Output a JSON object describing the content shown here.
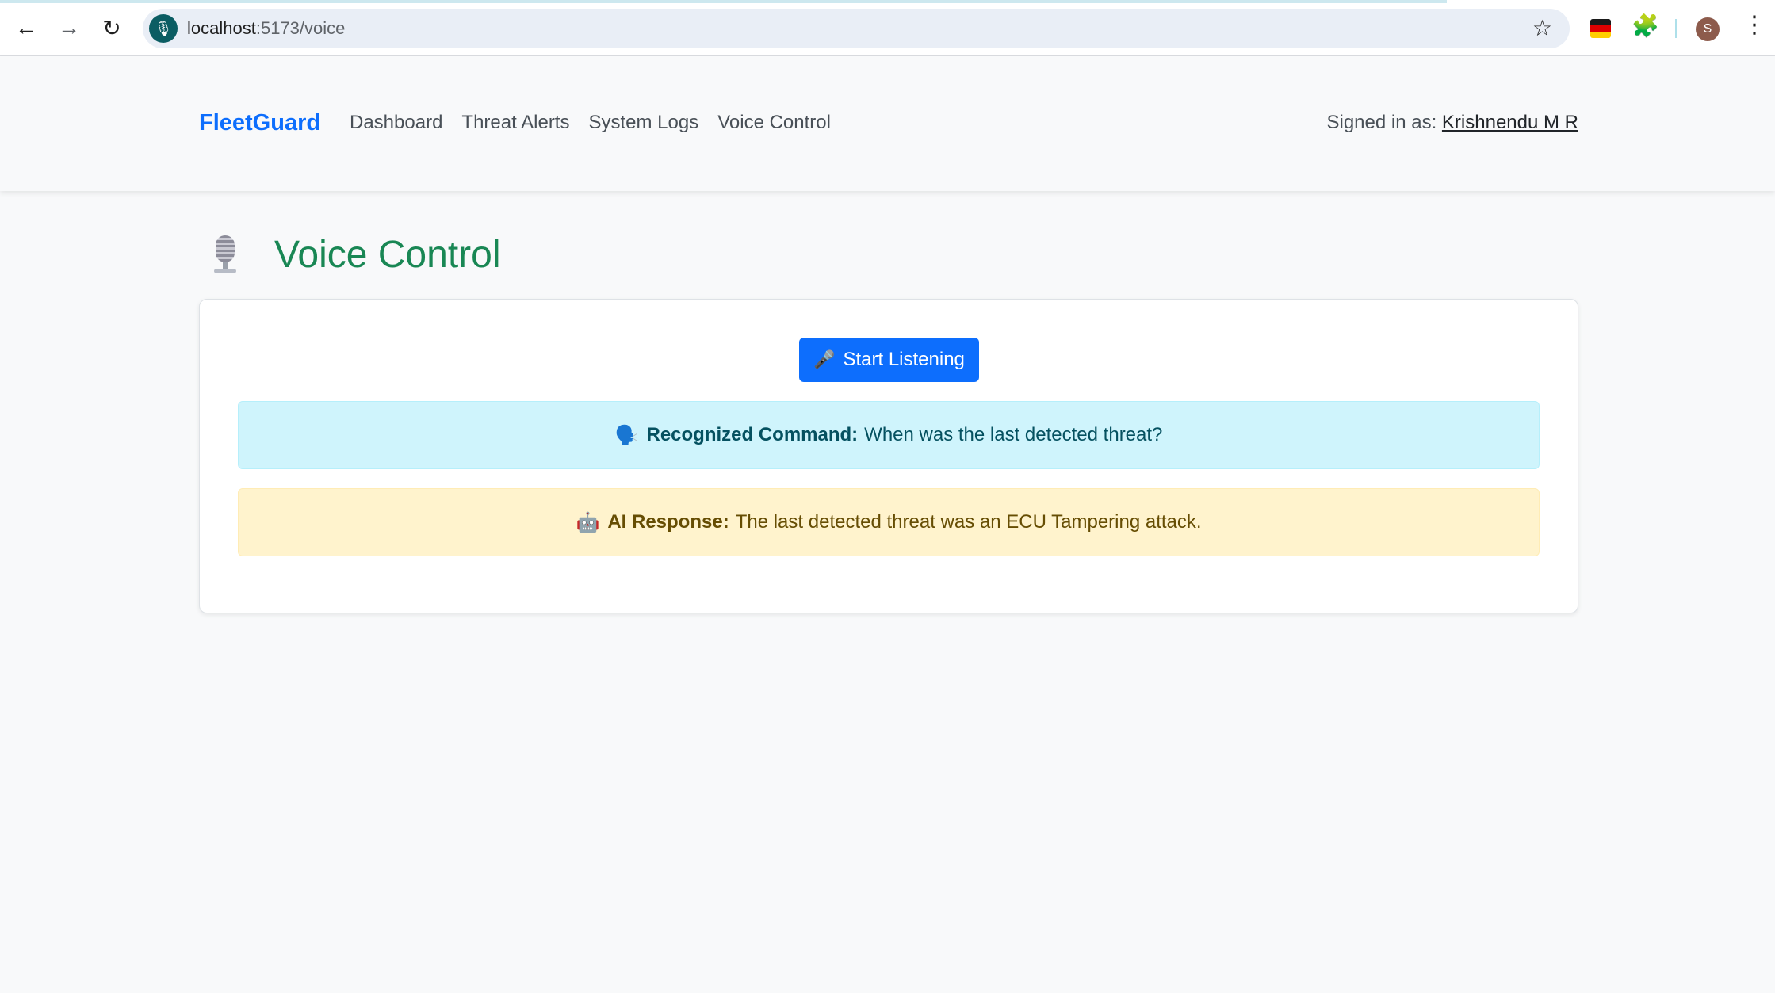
{
  "browser": {
    "url_host": "localhost",
    "url_path": ":5173/voice",
    "profile_initial": "S"
  },
  "navbar": {
    "brand": "FleetGuard",
    "links": [
      "Dashboard",
      "Threat Alerts",
      "System Logs",
      "Voice Control"
    ],
    "signed_in_label": "Signed in as:",
    "user_name": "Krishnendu M R"
  },
  "page": {
    "title": "Voice Control",
    "title_icon": "microphone-icon"
  },
  "card": {
    "start_button": {
      "icon": "🎤",
      "label": "Start Listening"
    },
    "recognized": {
      "icon": "🗣️",
      "label": "Recognized Command:",
      "text": "When was the last detected threat?"
    },
    "response": {
      "icon": "🤖",
      "label": "AI Response:",
      "text": "The last detected threat was an ECU Tampering attack."
    }
  },
  "colors": {
    "brand": "#0d6efd",
    "title": "#198754",
    "button": "#0d6efd",
    "info_bg": "#cff4fc",
    "warning_bg": "#fff3cd"
  }
}
